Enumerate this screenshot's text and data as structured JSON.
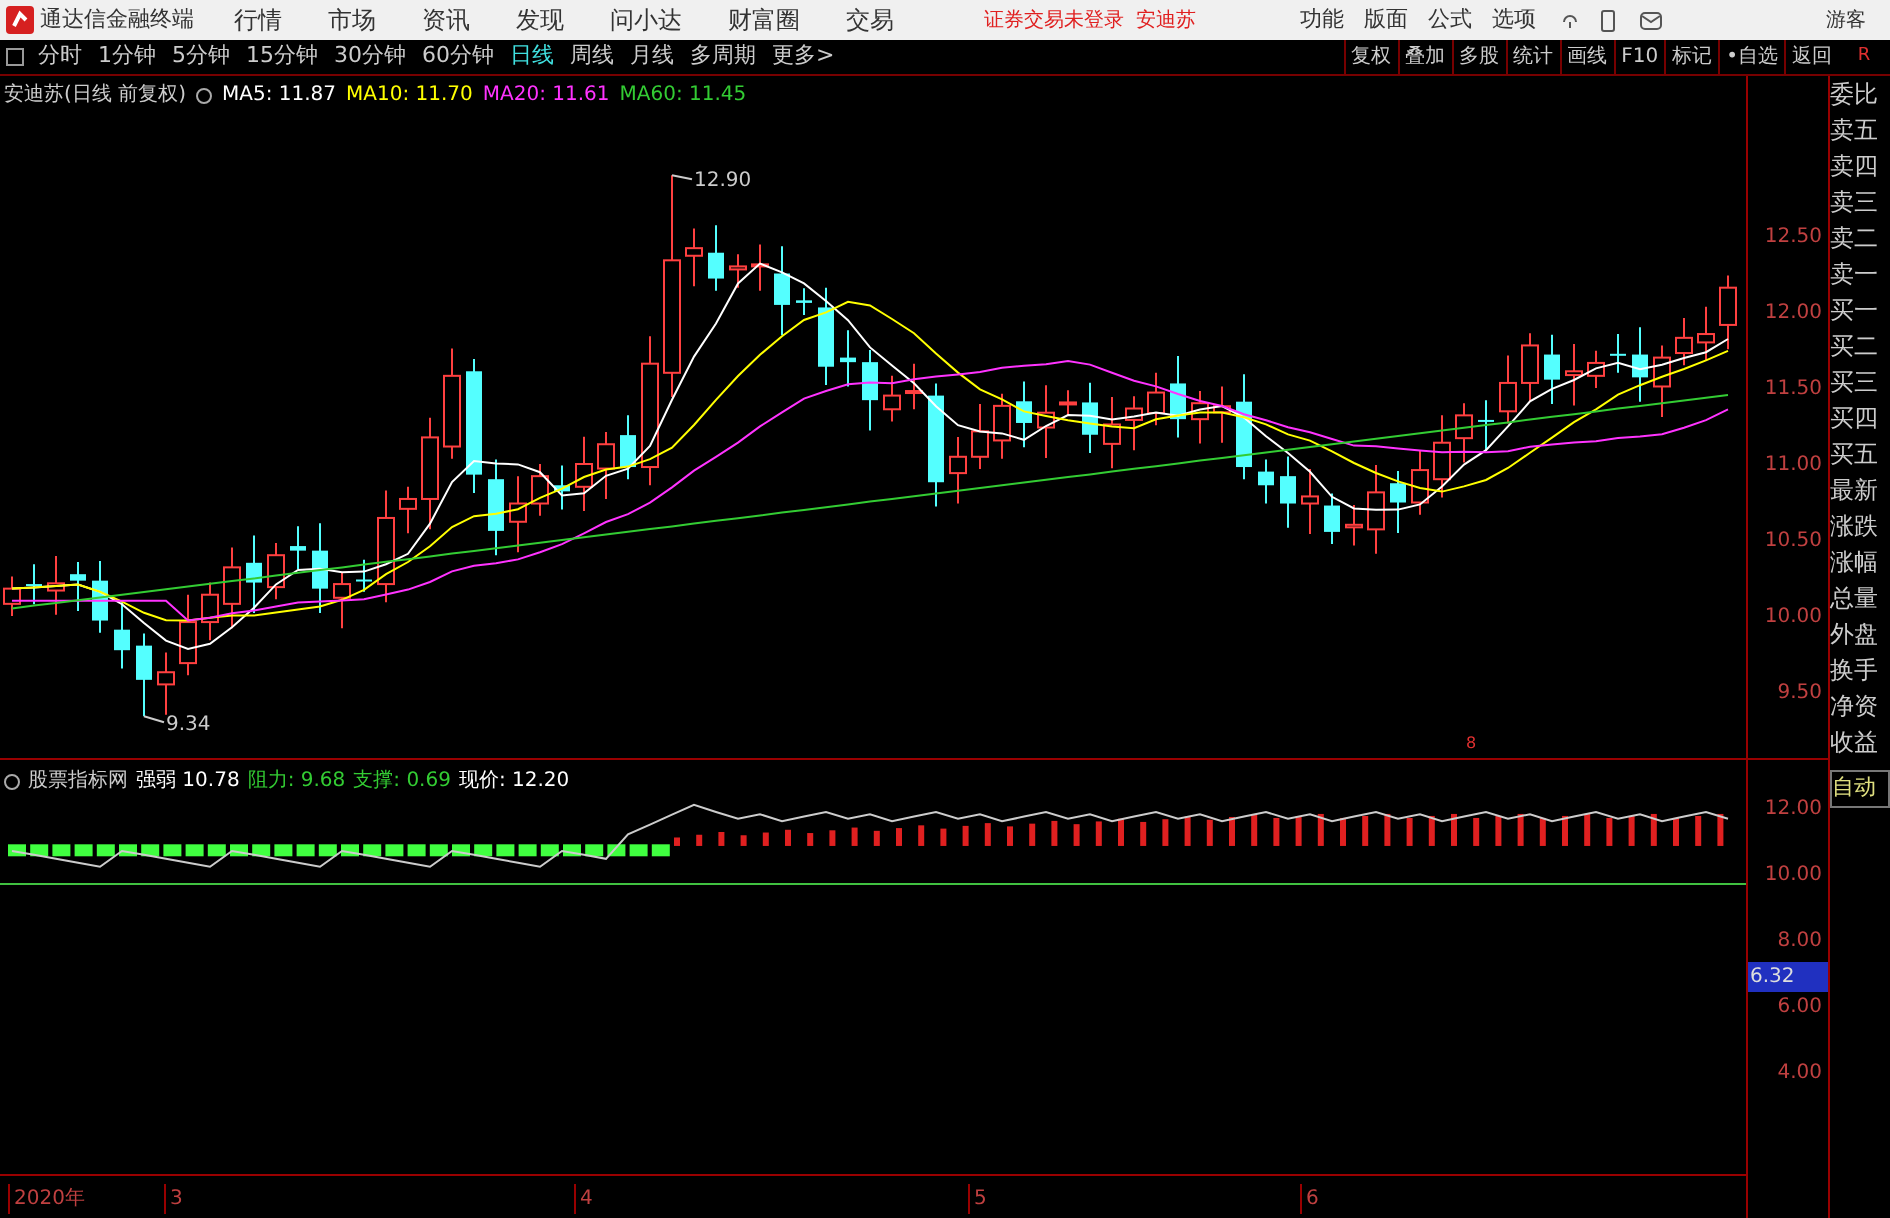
{
  "app_bar": {
    "title": "通达信金融终端",
    "menus": [
      "行情",
      "市场",
      "资讯",
      "发现",
      "问小达",
      "财富圈",
      "交易"
    ],
    "notice": "证券交易未登录",
    "stock": "安迪苏",
    "tools": [
      "功能",
      "版面",
      "公式",
      "选项"
    ],
    "user": "游客"
  },
  "period_tabs": [
    {
      "label": "分时",
      "selected": false
    },
    {
      "label": "1分钟",
      "selected": false
    },
    {
      "label": "5分钟",
      "selected": false
    },
    {
      "label": "15分钟",
      "selected": false
    },
    {
      "label": "30分钟",
      "selected": false
    },
    {
      "label": "60分钟",
      "selected": false
    },
    {
      "label": "日线",
      "selected": true
    },
    {
      "label": "周线",
      "selected": false
    },
    {
      "label": "月线",
      "selected": false
    },
    {
      "label": "多周期",
      "selected": false
    },
    {
      "label": "更多>",
      "selected": false
    }
  ],
  "chart_buttons": [
    "复权",
    "叠加",
    "多股",
    "统计",
    "画线",
    "F10",
    "标记",
    "•自选",
    "返回"
  ],
  "corner_mark": "R",
  "chart": {
    "title": "安迪苏(日线 前复权)",
    "ma_legend": [
      {
        "label": "MA5: 11.87",
        "color": "#ffffff"
      },
      {
        "label": "MA10: 11.70",
        "color": "#ffff00"
      },
      {
        "label": "MA20: 11.61",
        "color": "#ff33ff"
      },
      {
        "label": "MA60: 11.45",
        "color": "#33cc33"
      }
    ],
    "high_label": "12.90",
    "low_label": "9.34",
    "event_mark": "8",
    "price_ticks": [
      "12.50",
      "12.00",
      "11.50",
      "11.00",
      "10.50",
      "10.00",
      "9.50"
    ]
  },
  "side_panel": {
    "items": [
      "委比",
      "卖五",
      "卖四",
      "卖三",
      "卖二",
      "卖一",
      "买一",
      "买二",
      "买三",
      "买四",
      "买五",
      "最新",
      "涨跌",
      "涨幅",
      "总量",
      "外盘",
      "换手",
      "净资",
      "收益"
    ],
    "mode": "自动"
  },
  "indicator": {
    "name": "股票指标网",
    "stats": [
      {
        "label": "强弱",
        "value": "10.78",
        "color": "#ffffff"
      },
      {
        "label": "阻力:",
        "value": "9.68",
        "color": "#33cc33"
      },
      {
        "label": "支撑:",
        "value": "0.69",
        "color": "#33cc33"
      },
      {
        "label": "现价:",
        "value": "12.20",
        "color": "#ffffff"
      }
    ],
    "ticks": [
      "12.00",
      "10.00",
      "8.00",
      "6.00",
      "4.00"
    ],
    "current": "6.32"
  },
  "time_axis": [
    "2020年",
    "3",
    "4",
    "5",
    "6"
  ]
}
